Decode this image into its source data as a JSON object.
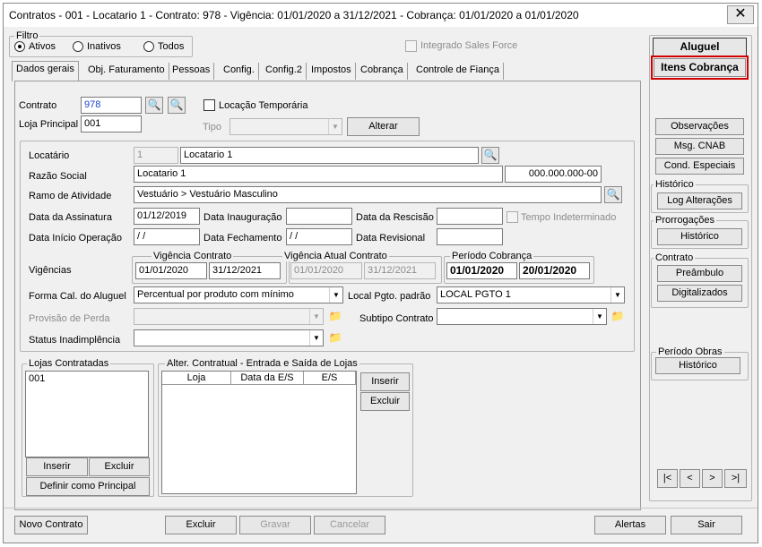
{
  "window": {
    "title": "Contratos - 001 - Locatario 1 - Contrato: 978 - Vigência: 01/01/2020 a 31/12/2021 - Cobrança: 01/01/2020 a 01/01/2020",
    "close": "✕"
  },
  "filtro": {
    "title": "Filtro",
    "options": [
      "Ativos",
      "Inativos",
      "Todos"
    ],
    "selected": "Ativos",
    "integrado_label": "Integrado Sales Force"
  },
  "tabs": [
    "Dados gerais",
    "Obj. Faturamento",
    "Pessoas",
    "Config.",
    "Config.2",
    "Impostos",
    "Cobrança",
    "Controle de Fiança"
  ],
  "active_tab": "Dados gerais",
  "form": {
    "contrato_label": "Contrato",
    "contrato_value": "978",
    "locacao_temporaria_label": "Locação Temporária",
    "loja_principal_label": "Loja Principal",
    "loja_principal_value": "001",
    "tipo_label": "Tipo",
    "tipo_value": "",
    "alterar_label": "Alterar",
    "locatario_label": "Locatário",
    "locatario_code": "1",
    "locatario_name": "Locatario 1",
    "razao_social_label": "Razão Social",
    "razao_social_value": "Locatario 1",
    "cnpj_value": "000.000.000-00",
    "ramo_label": "Ramo de Atividade",
    "ramo_value": "Vestuário > Vestuário Masculino",
    "data_assinatura_label": "Data da Assinatura",
    "data_assinatura_value": "01/12/2019",
    "data_inauguracao_label": "Data Inauguração",
    "data_inauguracao_value": "",
    "data_rescisao_label": "Data da Rescisão",
    "data_rescisao_value": "",
    "tempo_indeterminado_label": "Tempo Indeterminado",
    "data_inicio_label": "Data Início Operação",
    "data_inicio_value": "/ /",
    "data_fechamento_label": "Data Fechamento",
    "data_fechamento_value": "/ /",
    "data_revisional_label": "Data Revisional",
    "data_revisional_value": "",
    "vigencias_label": "Vigências",
    "vigencia_contrato_title": "Vigência Contrato",
    "vigencia_contrato_inicio": "01/01/2020",
    "vigencia_contrato_fim": "31/12/2021",
    "vigencia_atual_title": "Vigência Atual Contrato",
    "vigencia_atual_inicio": "01/01/2020",
    "vigencia_atual_fim": "31/12/2021",
    "periodo_cobranca_title": "Período Cobrança",
    "periodo_cobranca_inicio": "01/01/2020",
    "periodo_cobranca_fim": "20/01/2020",
    "forma_cal_label": "Forma Cal. do Aluguel",
    "forma_cal_value": "Percentual por produto com mínimo",
    "local_pgto_label": "Local Pgto. padrão",
    "local_pgto_value": "LOCAL PGTO 1",
    "provisao_label": "Provisão de Perda",
    "provisao_value": "",
    "subtipo_label": "Subtipo Contrato",
    "subtipo_value": "",
    "status_label": "Status Inadimplência",
    "status_value": ""
  },
  "lojas": {
    "title": "Lojas Contratadas",
    "items": [
      "001"
    ],
    "inserir": "Inserir",
    "excluir": "Excluir",
    "definir": "Definir como Principal"
  },
  "alter": {
    "title": "Alter. Contratual - Entrada e Saída de Lojas",
    "columns": [
      "Loja",
      "Data da E/S",
      "E/S"
    ],
    "inserir": "Inserir",
    "excluir": "Excluir"
  },
  "side": {
    "aluguel": "Aluguel",
    "itens_cobranca": "Itens Cobrança",
    "observacoes": "Observações",
    "msg_cnab": "Msg. CNAB",
    "cond_especiais": "Cond. Especiais",
    "historico_title": "Histórico",
    "log_alteracoes": "Log Alterações",
    "prorrogacoes_title": "Prorrogações",
    "historico_btn": "Histórico",
    "contrato_title": "Contrato",
    "preambulo": "Preâmbulo",
    "digitalizados": "Digitalizados",
    "periodo_obras_title": "Período Obras",
    "periodo_obras_btn": "Histórico",
    "nav": [
      "|<",
      "<",
      ">",
      ">|"
    ]
  },
  "bottom": {
    "novo_contrato": "Novo Contrato",
    "excluir": "Excluir",
    "gravar": "Gravar",
    "cancelar": "Cancelar",
    "alertas": "Alertas",
    "sair": "Sair"
  },
  "icons": {
    "binoculars": "binoculars-icon",
    "folder": "folder-icon",
    "dropdown": "chevron-down-icon"
  },
  "colors": {
    "highlight": "#d10000",
    "contract_number": "#1a3fd0"
  }
}
